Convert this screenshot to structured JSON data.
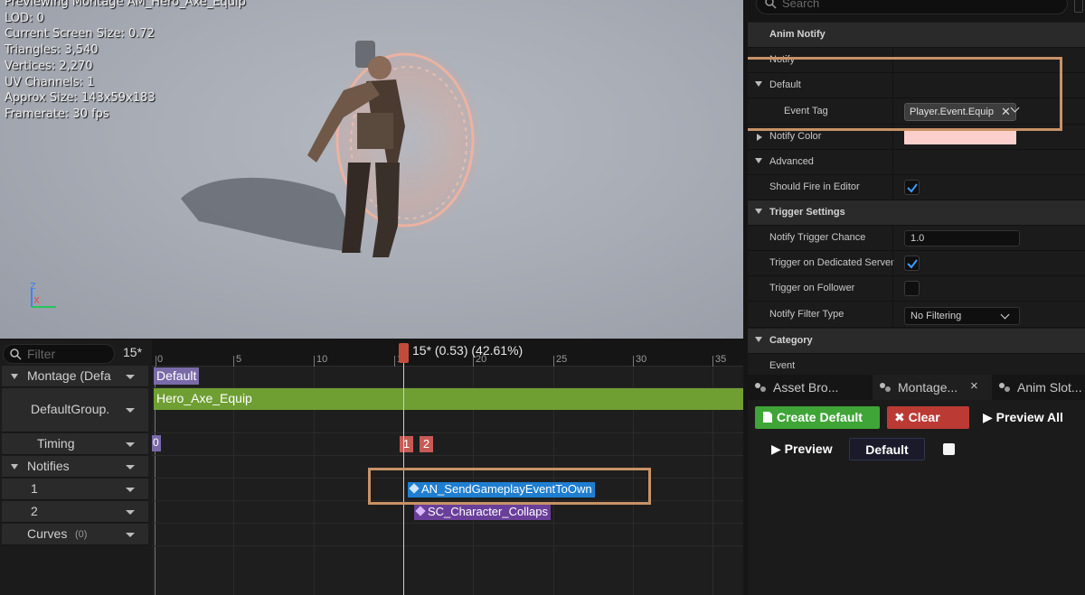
{
  "viewport": {
    "stats": [
      "Previewing Montage AM_Hero_Axe_Equip",
      "LOD: 0",
      "Current Screen Size: 0.72",
      "Triangles: 3,540",
      "Vertices: 2,270",
      "UV Channels: 1",
      "Approx Size: 143x59x183",
      "Framerate: 30 fps"
    ],
    "gizmo": {
      "z": "Z",
      "x": "X"
    }
  },
  "details": {
    "search_placeholder": "Search",
    "anim_notify": "Anim Notify",
    "notify": "Notify",
    "default": "Default",
    "event_tag_label": "Event Tag",
    "event_tag_value": "Player.Event.Equip",
    "notify_color_label": "Notify Color",
    "notify_color": "#fbd0cc",
    "advanced": "Advanced",
    "should_fire_label": "Should Fire in Editor",
    "trigger_settings": "Trigger Settings",
    "notify_trigger_chance_label": "Notify Trigger Chance",
    "notify_trigger_chance_value": "1.0",
    "trigger_dedicated_label": "Trigger on Dedicated Server",
    "trigger_follower_label": "Trigger on Follower",
    "notify_filter_type_label": "Notify Filter Type",
    "notify_filter_type_value": "No Filtering",
    "category": "Category",
    "event": "Event"
  },
  "tabs": [
    {
      "label": "Asset Bro..."
    },
    {
      "label": "Montage...",
      "close": "×"
    },
    {
      "label": "Anim Slot..."
    }
  ],
  "montage_panel": {
    "create_default": "Create Default",
    "clear": "Clear",
    "preview_all": "Preview All",
    "preview": "Preview",
    "default": "Default"
  },
  "tracks": {
    "filter_placeholder": "Filter",
    "frame_count": "15*",
    "montage": "Montage (Defa",
    "default_group": "DefaultGroup.",
    "timing": "Timing",
    "notifies": "Notifies",
    "track1": "1",
    "track2": "2",
    "curves": "Curves",
    "curves_count": "(0)"
  },
  "timeline": {
    "ticks": [
      "0",
      "5",
      "10",
      "15",
      "20",
      "25",
      "30",
      "35"
    ],
    "playhead_text": "15* (0.53) (42.61%)",
    "default_slot": "Default",
    "segment": "Hero_Axe_Equip",
    "timing_start": "0",
    "section1": "1",
    "section2": "2",
    "notify1": "AN_SendGameplayEventToOwn",
    "notify2": "SC_Character_Collaps"
  }
}
